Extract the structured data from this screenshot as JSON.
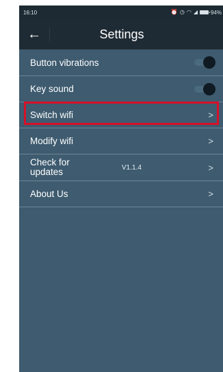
{
  "status_bar": {
    "time": "16:10",
    "battery": "94%"
  },
  "header": {
    "back_icon": "arrow-left-icon",
    "title": "Settings"
  },
  "items": [
    {
      "label": "Button vibrations",
      "control": "toggle",
      "state": "on"
    },
    {
      "label": "Key sound",
      "control": "toggle",
      "state": "on"
    },
    {
      "label": "Switch wifi",
      "control": "chevron",
      "highlighted": true
    },
    {
      "label": "Modify wifi",
      "control": "chevron"
    },
    {
      "label": "Check for updates",
      "value": "V1.1.4",
      "control": "chevron"
    },
    {
      "label": "About Us",
      "control": "chevron"
    }
  ],
  "chevron_glyph": ">",
  "colors": {
    "background": "#3e5b6f",
    "header": "#1f2b34",
    "highlight": "#d8102a"
  }
}
